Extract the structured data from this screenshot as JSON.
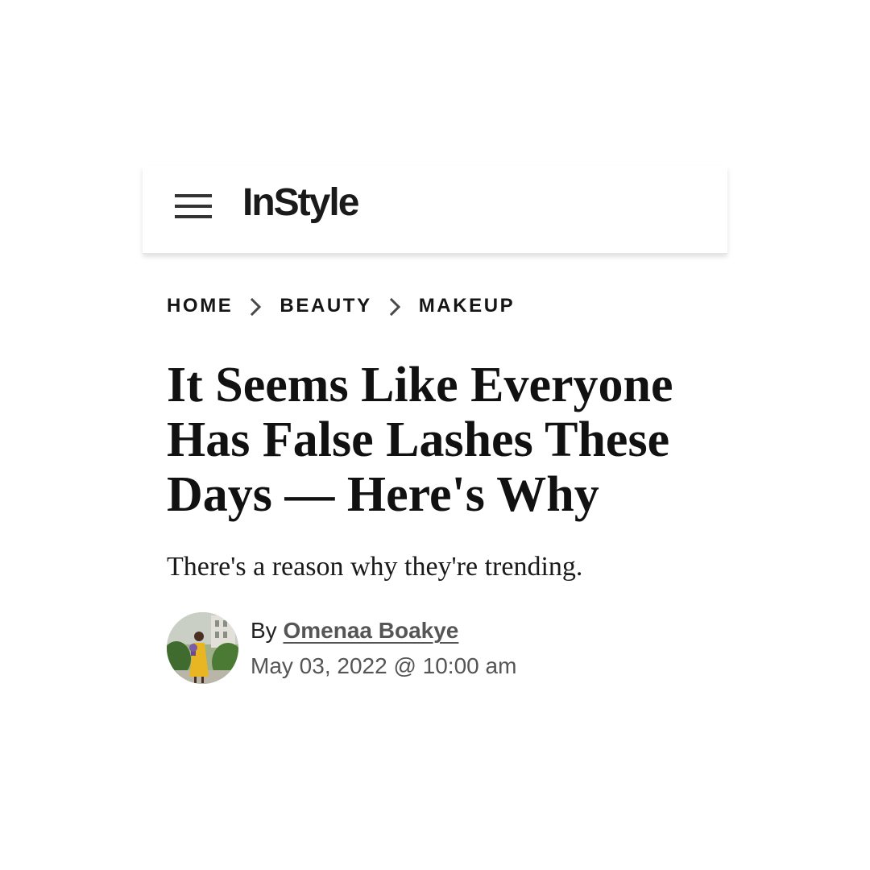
{
  "header": {
    "menu_icon": "hamburger-menu-icon",
    "logo_text": "InStyle"
  },
  "breadcrumb": {
    "items": [
      "HOME",
      "BEAUTY",
      "MAKEUP"
    ],
    "separator_icon": "chevron-right-icon"
  },
  "article": {
    "title": "It Seems Like Everyone Has False Lashes These Days — Here's Why",
    "subtitle": "There's a reason why they're trending.",
    "byline_prefix": "By",
    "author": "Omenaa Boakye",
    "date": "May 03, 2022 @ 10:00 am"
  },
  "colors": {
    "text": "#111111",
    "muted": "#555555",
    "avatar_dress": "#e8b623",
    "avatar_greenery": "#3f6b2e"
  }
}
